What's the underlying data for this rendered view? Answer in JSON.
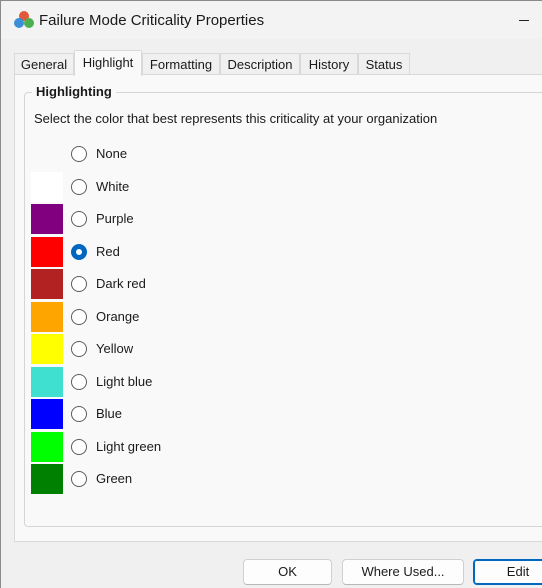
{
  "window": {
    "title": "Failure Mode Criticality Properties"
  },
  "tabs": [
    {
      "label": "General",
      "active": false
    },
    {
      "label": "Highlight",
      "active": true
    },
    {
      "label": "Formatting",
      "active": false
    },
    {
      "label": "Description",
      "active": false
    },
    {
      "label": "History",
      "active": false
    },
    {
      "label": "Status",
      "active": false
    }
  ],
  "highlight": {
    "group_title": "Highlighting",
    "instruction": "Select the color that best represents this criticality at your organization",
    "selected": "Red",
    "options": [
      {
        "label": "None",
        "color": null,
        "selected": false
      },
      {
        "label": "White",
        "color": "#ffffff",
        "selected": false
      },
      {
        "label": "Purple",
        "color": "#800080",
        "selected": false
      },
      {
        "label": "Red",
        "color": "#ff0000",
        "selected": true
      },
      {
        "label": "Dark red",
        "color": "#b22222",
        "selected": false
      },
      {
        "label": "Orange",
        "color": "#ffa500",
        "selected": false
      },
      {
        "label": "Yellow",
        "color": "#ffff00",
        "selected": false
      },
      {
        "label": "Light blue",
        "color": "#40e0d0",
        "selected": false
      },
      {
        "label": "Blue",
        "color": "#0000ff",
        "selected": false
      },
      {
        "label": "Light green",
        "color": "#00ff00",
        "selected": false
      },
      {
        "label": "Green",
        "color": "#008000",
        "selected": false
      }
    ]
  },
  "buttons": {
    "ok": "OK",
    "where_used": "Where Used...",
    "edit": "Edit"
  },
  "colors": {
    "accent": "#0067c0"
  }
}
